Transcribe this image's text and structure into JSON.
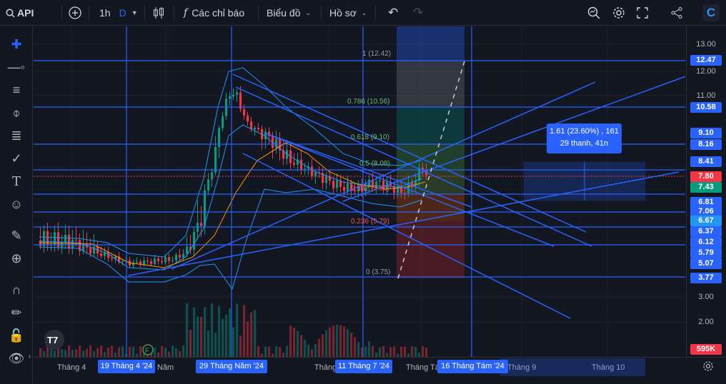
{
  "toolbar": {
    "symbol": "API",
    "interval": "1h",
    "interval_flag": "D",
    "indicators": "Các chỉ báo",
    "layout": "Biểu đồ",
    "profile": "Hồ sơ"
  },
  "price_scale": {
    "ticks": [
      "13.00",
      "12.00",
      "11.00",
      "3.00",
      "2.00"
    ],
    "tags": [
      {
        "v": "12.47",
        "color": "#2962ff"
      },
      {
        "v": "10.58",
        "color": "#2962ff"
      },
      {
        "v": "9.10",
        "color": "#2962ff"
      },
      {
        "v": "8.16",
        "color": "#2962ff"
      },
      {
        "v": "8.41",
        "color": "#2962ff"
      },
      {
        "v": "7.80",
        "color": "#f23645"
      },
      {
        "v": "7.43",
        "color": "#089981"
      },
      {
        "v": "6.81",
        "color": "#2962ff"
      },
      {
        "v": "7.06",
        "color": "#2962ff"
      },
      {
        "v": "6.67",
        "color": "#2196f3"
      },
      {
        "v": "6.37",
        "color": "#2962ff"
      },
      {
        "v": "6.12",
        "color": "#2962ff"
      },
      {
        "v": "5.79",
        "color": "#2962ff"
      },
      {
        "v": "5.07",
        "color": "#2962ff"
      },
      {
        "v": "3.77",
        "color": "#2962ff"
      }
    ],
    "volume_tag": "595K"
  },
  "fib": [
    {
      "label": "1 (12.42)",
      "color": "#9598a1"
    },
    {
      "label": "0.786 (10.56)",
      "color": "#66bb6a"
    },
    {
      "label": "0.618 (9.10)",
      "color": "#66bb6a"
    },
    {
      "label": "0.5 (8.08)",
      "color": "#66bb6a"
    },
    {
      "label": "0.382 (7.06)",
      "color": "#ef5350"
    },
    {
      "label": "0.236 (5.79)",
      "color": "#ef5350"
    },
    {
      "label": "0 (3.75)",
      "color": "#9598a1"
    }
  ],
  "measure": {
    "line1": "1.61 (23.60%) , 161",
    "line2": "29 thanh, 41n"
  },
  "time_axis": {
    "labels": [
      "Tháng 4",
      "Năm",
      "Tháng",
      "Tháng Tá",
      "Tháng 9",
      "Tháng 10"
    ],
    "highlights": [
      "19 Tháng 4 '24",
      "29 Tháng Năm '24",
      "11 Tháng 7 '24",
      "16 Tháng Tám '24"
    ]
  },
  "colors": {
    "up": "#089981",
    "down": "#f23645",
    "line": "#2962ff"
  }
}
